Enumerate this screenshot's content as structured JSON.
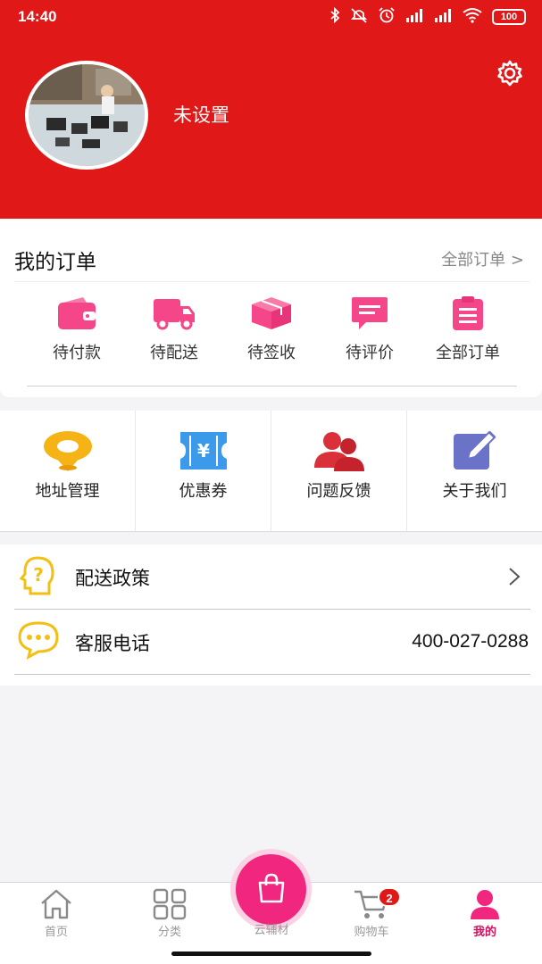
{
  "status": {
    "time": "14:40",
    "battery": "100"
  },
  "profile": {
    "username": "未设置"
  },
  "orders": {
    "title": "我的订单",
    "all_link": "全部订单 >",
    "items": [
      {
        "label": "待付款",
        "icon": "wallet-icon"
      },
      {
        "label": "待配送",
        "icon": "truck-icon"
      },
      {
        "label": "待签收",
        "icon": "package-icon"
      },
      {
        "label": "待评价",
        "icon": "comment-icon"
      },
      {
        "label": "全部订单",
        "icon": "clipboard-icon"
      }
    ]
  },
  "menu": [
    {
      "label": "地址管理",
      "icon": "location-icon"
    },
    {
      "label": "优惠券",
      "icon": "coupon-icon"
    },
    {
      "label": "问题反馈",
      "icon": "users-icon"
    },
    {
      "label": "关于我们",
      "icon": "edit-icon"
    }
  ],
  "list": {
    "delivery": {
      "label": "配送政策"
    },
    "service": {
      "label": "客服电话",
      "value": "400-027-0288"
    }
  },
  "tabs": [
    {
      "label": "首页",
      "icon": "home-icon"
    },
    {
      "label": "分类",
      "icon": "grid-icon"
    },
    {
      "label": "云辅材",
      "icon": "shopping-bag-icon"
    },
    {
      "label": "购物车",
      "icon": "cart-icon",
      "badge": "2"
    },
    {
      "label": "我的",
      "icon": "user-icon",
      "active": true
    }
  ],
  "colors": {
    "header": "#e01818",
    "accent": "#f0267f",
    "active_tab": "#d0115c"
  }
}
